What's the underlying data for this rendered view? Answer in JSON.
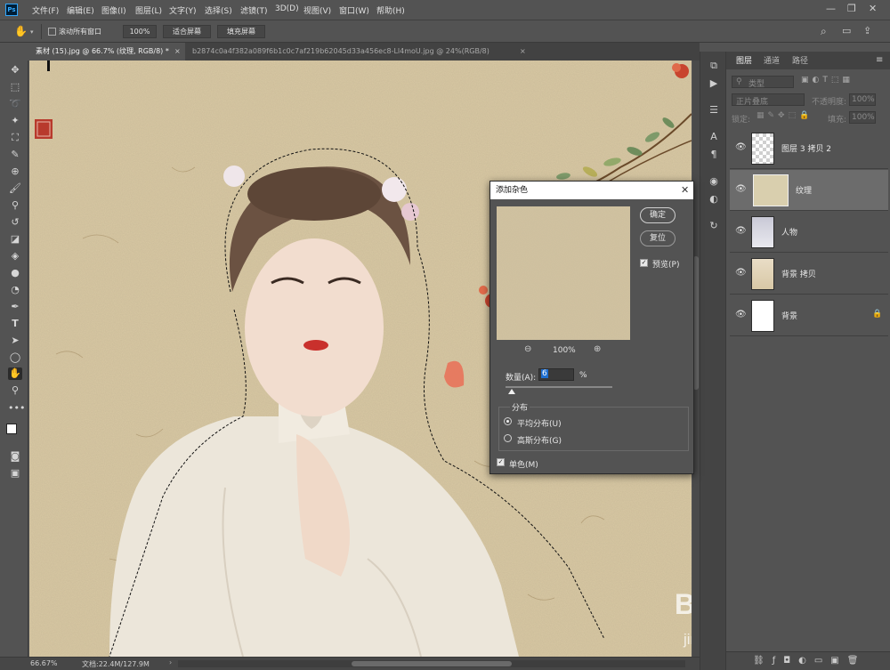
{
  "app": {
    "logo": "Ps"
  },
  "menu": [
    "文件(F)",
    "编辑(E)",
    "图像(I)",
    "图层(L)",
    "文字(Y)",
    "选择(S)",
    "滤镜(T)",
    "3D(D)",
    "视图(V)",
    "窗口(W)",
    "帮助(H)"
  ],
  "window_controls": {
    "minimize": "—",
    "restore": "❐",
    "close": "✕"
  },
  "options_bar": {
    "scroll_all_label": "滚动所有窗口",
    "zoom_button": "100%",
    "fit_screen": "适合屏幕",
    "fill_screen": "填充屏幕"
  },
  "doc_tabs": [
    {
      "label": "素材 (15).jpg @ 66.7% (纹理, RGB/8) *",
      "close": "×"
    },
    {
      "label": "b2874c0a4f382a089f6b1c0c7af219b62045d33a456ec8-Ll4moU.jpg @ 24%(RGB/8)",
      "close": "×"
    }
  ],
  "status": {
    "zoom": "66.67%",
    "doc": "文档:22.4M/127.9M"
  },
  "layers_panel": {
    "tabs": [
      "图层",
      "通道",
      "路径"
    ],
    "kind_filter": "类型",
    "blend_mode": "正片叠底",
    "opacity_label": "不透明度:",
    "opacity_value": "100%",
    "lock_label": "锁定:",
    "fill_label": "填充:",
    "fill_value": "100%",
    "layers": [
      {
        "name": "图层 3 拷贝 2"
      },
      {
        "name": "纹理"
      },
      {
        "name": "人物"
      },
      {
        "name": "背景 拷贝"
      },
      {
        "name": "背景"
      }
    ]
  },
  "dialog": {
    "title": "添加杂色",
    "ok": "确定",
    "reset": "复位",
    "preview_label": "预览(P)",
    "zoom": "100%",
    "amount_label": "数量(A):",
    "amount_value": "6",
    "amount_unit": "%",
    "amount_slider": 0.06,
    "distribution_label": "分布",
    "uniform": "平均分布(U)",
    "gaussian": "高斯分布(G)",
    "mono": "单色(M)"
  },
  "watermark": {
    "brand": "Bai 经验",
    "url": "jingyan.baidu.com"
  }
}
